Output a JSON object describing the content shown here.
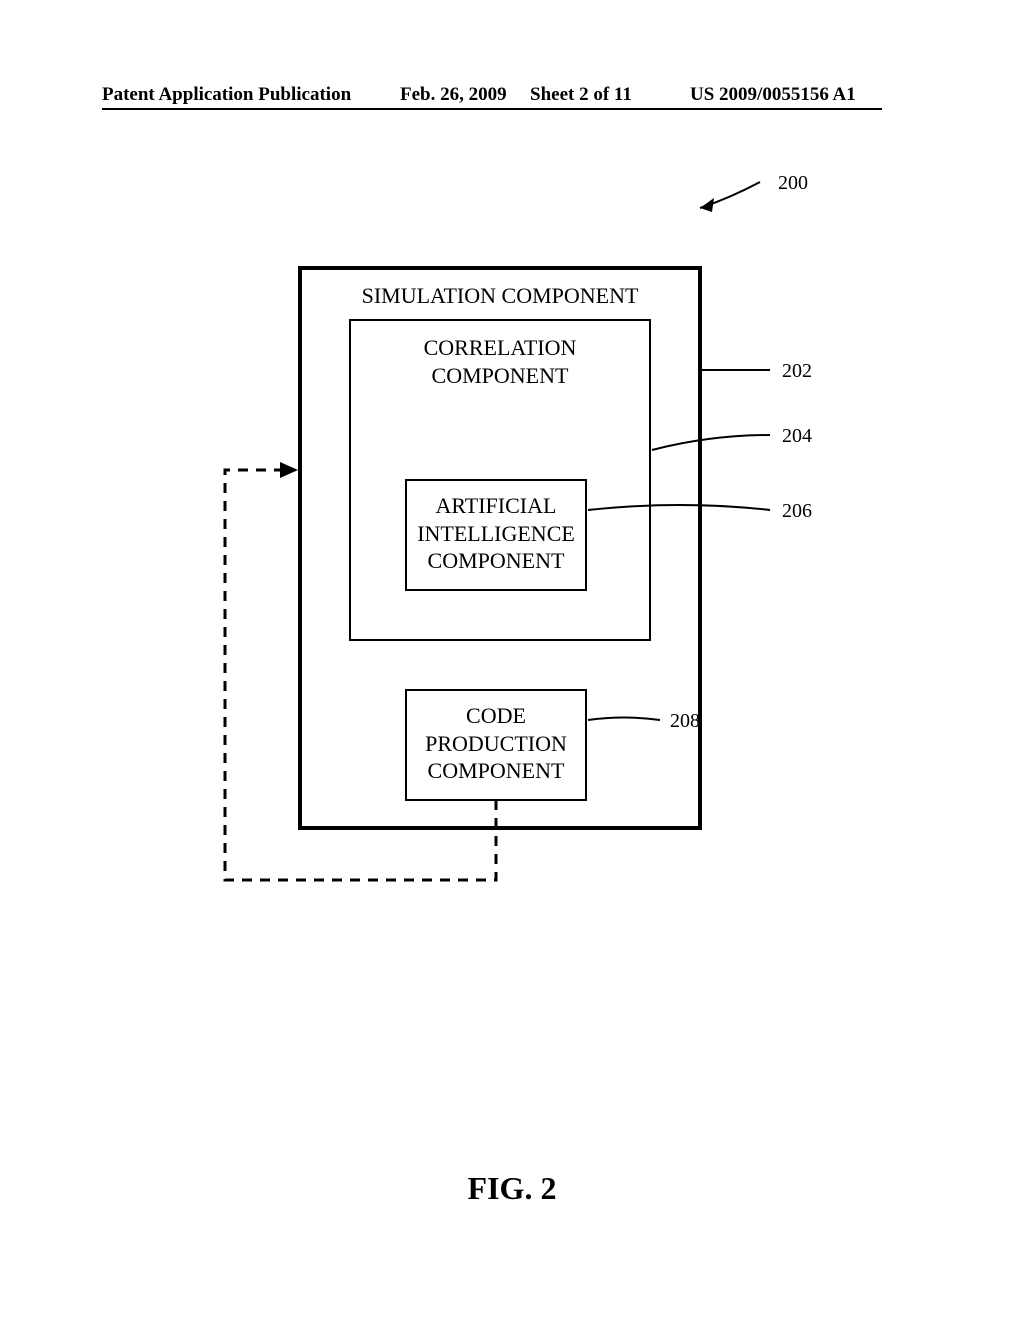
{
  "header": {
    "publication_label": "Patent Application Publication",
    "date": "Feb. 26, 2009",
    "sheet": "Sheet 2 of 11",
    "pub_number": "US 2009/0055156 A1"
  },
  "figure": {
    "caption": "FIG. 2",
    "ref_diagram": "200",
    "outer_box": {
      "title": "SIMULATION COMPONENT",
      "ref": "202"
    },
    "correlation_box": {
      "title": "CORRELATION\nCOMPONENT",
      "ref": "204"
    },
    "ai_box": {
      "title": "ARTIFICIAL\nINTELLIGENCE\nCOMPONENT",
      "ref": "206"
    },
    "code_box": {
      "title": "CODE\nPRODUCTION\nCOMPONENT",
      "ref": "208"
    }
  }
}
